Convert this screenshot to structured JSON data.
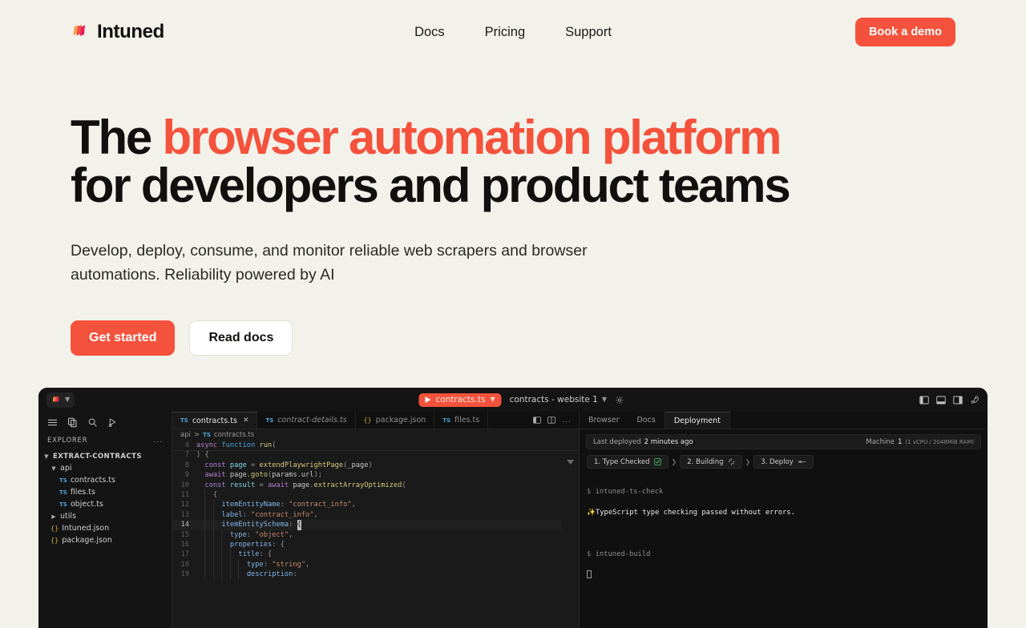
{
  "header": {
    "brand": "Intuned",
    "nav": [
      {
        "label": "Docs"
      },
      {
        "label": "Pricing"
      },
      {
        "label": "Support"
      }
    ],
    "cta": "Book a demo"
  },
  "hero": {
    "title_part1": "The ",
    "title_accent": "browser automation platform",
    "title_part2": " for developers and product teams",
    "subtitle": "Develop, deploy, consume, and monitor reliable web scrapers and browser automations. Reliability powered by AI",
    "primary_button": "Get started",
    "secondary_button": "Read docs"
  },
  "colors": {
    "page_bg": "#f2f1ea",
    "accent": "#f4523c",
    "text": "#12100e",
    "ide_bg": "#141414",
    "success": "#4ec46e"
  },
  "ide": {
    "titlebar": {
      "run_target": "contracts.ts",
      "context": "contracts - website 1",
      "gear_icon": "gear-icon",
      "layout_icons": [
        "panel-left-icon",
        "panel-bottom-icon",
        "panel-right-icon",
        "rocket-icon"
      ]
    },
    "activity_icons": [
      "menu-icon",
      "files-icon",
      "search-icon",
      "run-debug-icon"
    ],
    "explorer": {
      "title": "EXPLORER",
      "more": "...",
      "root": "EXTRACT-CONTRACTS",
      "items": [
        {
          "label": "api",
          "type": "folder",
          "open": true,
          "depth": 1
        },
        {
          "label": "contracts.ts",
          "type": "ts",
          "depth": 2
        },
        {
          "label": "files.ts",
          "type": "ts",
          "depth": 2
        },
        {
          "label": "object.ts",
          "type": "ts",
          "depth": 2
        },
        {
          "label": "utils",
          "type": "folder",
          "open": false,
          "depth": 1
        },
        {
          "label": "Intuned.json",
          "type": "json",
          "depth": 1
        },
        {
          "label": "package.json",
          "type": "json",
          "depth": 1
        }
      ]
    },
    "tabs": [
      {
        "label": "contracts.ts",
        "icon": "TS",
        "active": true,
        "preview": false,
        "closable": true
      },
      {
        "label": "contract-details.ts",
        "icon": "TS",
        "active": false,
        "preview": true,
        "closable": false
      },
      {
        "label": "package.json",
        "icon": "{}",
        "active": false,
        "preview": false,
        "closable": false
      },
      {
        "label": "files.ts",
        "icon": "TS",
        "active": false,
        "preview": false,
        "closable": false
      }
    ],
    "tab_actions": [
      "split-editor-icon",
      "split-editor-group-icon",
      "more-actions-icon"
    ],
    "breadcrumb": {
      "folder": "api",
      "sep": ">",
      "icon": "TS",
      "file": "contracts.ts"
    },
    "code": {
      "sticky": {
        "num": "4",
        "text": "async function run("
      },
      "lines": [
        {
          "num": "7",
          "text": ") {"
        },
        {
          "num": "8",
          "text": "  const page = extendPlaywrightPage(_page)"
        },
        {
          "num": "9",
          "text": "  await page.goto(params.url);"
        },
        {
          "num": "10",
          "text": "  const result = await page.extractArrayOptimized("
        },
        {
          "num": "11",
          "text": "    {"
        },
        {
          "num": "12",
          "text": "      itemEntityName: \"contract_info\","
        },
        {
          "num": "13",
          "text": "      label: \"contract_info\","
        },
        {
          "num": "14",
          "text": "      itemEntitySchema: {",
          "current": true
        },
        {
          "num": "15",
          "text": "        type: \"object\","
        },
        {
          "num": "16",
          "text": "        properties: {"
        },
        {
          "num": "17",
          "text": "          title: {"
        },
        {
          "num": "18",
          "text": "            type: \"string\","
        },
        {
          "num": "19",
          "text": "            description:"
        }
      ]
    },
    "right_panel": {
      "tabs": [
        {
          "label": "Browser",
          "active": false
        },
        {
          "label": "Docs",
          "active": false
        },
        {
          "label": "Deployment",
          "active": true
        }
      ],
      "deploy_bar": {
        "label": "Last deployed",
        "value": "2 minutes ago",
        "machine_label": "Machine",
        "machine_number": "1",
        "machine_spec": "(1 vCPU / 2048MiB RAM)"
      },
      "steps": [
        {
          "label": "1. Type Checked",
          "state": "done",
          "icon": "check-square-icon"
        },
        {
          "label": "2. Building",
          "state": "running",
          "icon": "spinner-icon"
        },
        {
          "label": "3. Deploy",
          "state": "pending",
          "icon": "dash-icon"
        }
      ],
      "terminal": {
        "prompt": "$",
        "line1_cmd": "intuned-ts-check",
        "line2_sparkle": "✨",
        "line2_text": "TypeScript type checking passed without errors.",
        "line3_cmd": "intuned-build"
      }
    }
  }
}
